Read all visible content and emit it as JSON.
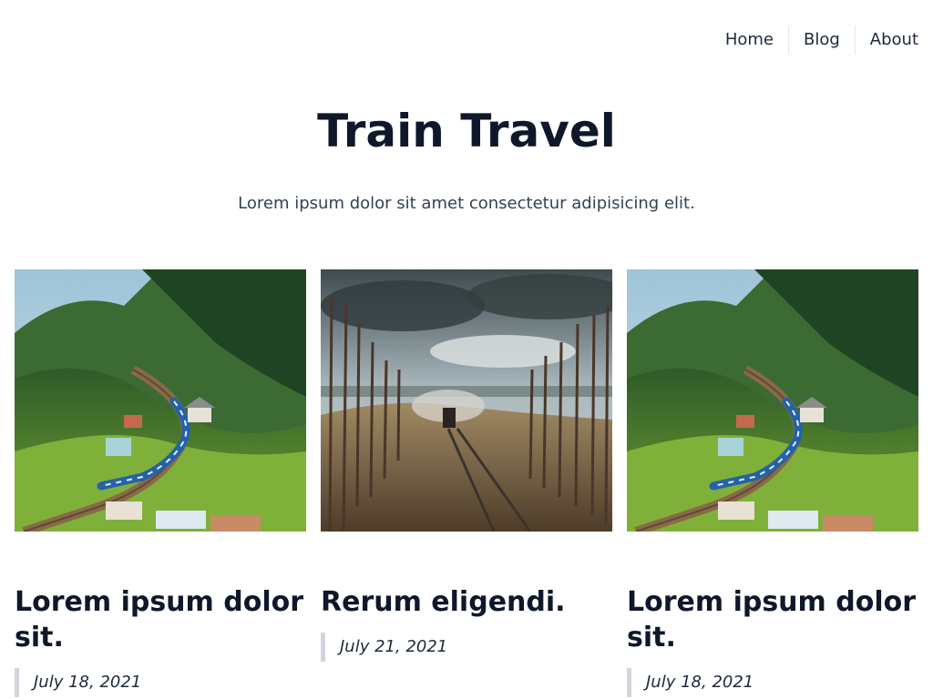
{
  "nav": {
    "items": [
      {
        "label": "Home"
      },
      {
        "label": "Blog"
      },
      {
        "label": "About"
      }
    ]
  },
  "hero": {
    "title": "Train Travel",
    "subtitle": "Lorem ipsum dolor sit amet consectetur adipisicing elit."
  },
  "cards": [
    {
      "title": "Lorem ipsum dolor sit.",
      "date": "July 18, 2021",
      "image": "train-in-green-valley"
    },
    {
      "title": "Rerum eligendi.",
      "date": "July 21, 2021",
      "image": "steam-train-in-forest"
    },
    {
      "title": "Lorem ipsum dolor sit.",
      "date": "July 18, 2021",
      "image": "train-in-green-valley"
    }
  ],
  "colors": {
    "heading": "#0f172a",
    "text": "#334155",
    "divider": "#e5e7eb",
    "quote_border": "#d1d5db"
  }
}
